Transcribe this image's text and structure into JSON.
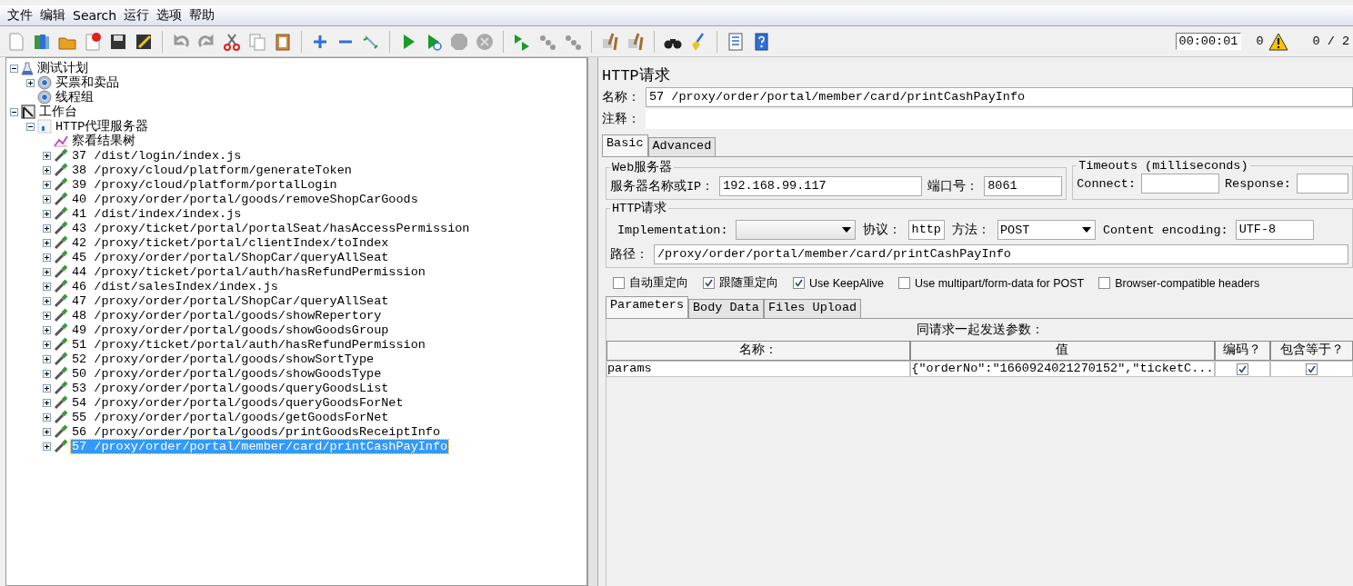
{
  "menu": [
    "文件",
    "编辑",
    "Search",
    "运行",
    "选项",
    "帮助"
  ],
  "status": {
    "timer": "00:00:01",
    "warnings": "0",
    "threads": "0 / 2"
  },
  "tree": [
    {
      "label": "测试计划",
      "kind": "plan",
      "expanded": true,
      "selected": false,
      "children": [
        {
          "label": "买票和卖品",
          "kind": "thread-group",
          "expanded": false,
          "selected": false
        },
        {
          "label": "线程组",
          "kind": "thread-group",
          "selected": false
        }
      ]
    },
    {
      "label": "工作台",
      "kind": "workbench",
      "expanded": true,
      "selected": false,
      "children": [
        {
          "label": "HTTP代理服务器",
          "kind": "proxy",
          "expanded": true,
          "selected": false,
          "children": [
            {
              "label": "察看结果树",
              "kind": "listener",
              "selected": false
            },
            {
              "label": "37 /dist/login/index.js",
              "kind": "sampler",
              "expanded": false,
              "selected": false
            },
            {
              "label": "38 /proxy/cloud/platform/generateToken",
              "kind": "sampler",
              "expanded": false,
              "selected": false
            },
            {
              "label": "39 /proxy/cloud/platform/portalLogin",
              "kind": "sampler",
              "expanded": false,
              "selected": false
            },
            {
              "label": "40 /proxy/order/portal/goods/removeShopCarGoods",
              "kind": "sampler",
              "expanded": false,
              "selected": false
            },
            {
              "label": "41 /dist/index/index.js",
              "kind": "sampler",
              "expanded": false,
              "selected": false
            },
            {
              "label": "43 /proxy/ticket/portal/portalSeat/hasAccessPermission",
              "kind": "sampler",
              "expanded": false,
              "selected": false
            },
            {
              "label": "42 /proxy/ticket/portal/clientIndex/toIndex",
              "kind": "sampler",
              "expanded": false,
              "selected": false
            },
            {
              "label": "45 /proxy/order/portal/ShopCar/queryAllSeat",
              "kind": "sampler",
              "expanded": false,
              "selected": false
            },
            {
              "label": "44 /proxy/ticket/portal/auth/hasRefundPermission",
              "kind": "sampler",
              "expanded": false,
              "selected": false
            },
            {
              "label": "46 /dist/salesIndex/index.js",
              "kind": "sampler",
              "expanded": false,
              "selected": false
            },
            {
              "label": "47 /proxy/order/portal/ShopCar/queryAllSeat",
              "kind": "sampler",
              "expanded": false,
              "selected": false
            },
            {
              "label": "48 /proxy/order/portal/goods/showRepertory",
              "kind": "sampler",
              "expanded": false,
              "selected": false
            },
            {
              "label": "49 /proxy/order/portal/goods/showGoodsGroup",
              "kind": "sampler",
              "expanded": false,
              "selected": false
            },
            {
              "label": "51 /proxy/ticket/portal/auth/hasRefundPermission",
              "kind": "sampler",
              "expanded": false,
              "selected": false
            },
            {
              "label": "52 /proxy/order/portal/goods/showSortType",
              "kind": "sampler",
              "expanded": false,
              "selected": false
            },
            {
              "label": "50 /proxy/order/portal/goods/showGoodsType",
              "kind": "sampler",
              "expanded": false,
              "selected": false
            },
            {
              "label": "53 /proxy/order/portal/goods/queryGoodsList",
              "kind": "sampler",
              "expanded": false,
              "selected": false
            },
            {
              "label": "54 /proxy/order/portal/goods/queryGoodsForNet",
              "kind": "sampler",
              "expanded": false,
              "selected": false
            },
            {
              "label": "55 /proxy/order/portal/goods/getGoodsForNet",
              "kind": "sampler",
              "expanded": false,
              "selected": false
            },
            {
              "label": "56 /proxy/order/portal/goods/printGoodsReceiptInfo",
              "kind": "sampler",
              "expanded": false,
              "selected": false
            },
            {
              "label": "57 /proxy/order/portal/member/card/printCashPayInfo",
              "kind": "sampler",
              "expanded": false,
              "selected": true
            }
          ]
        }
      ]
    }
  ],
  "panel": {
    "title": "HTTP请求",
    "name_label": "名称：",
    "name_value": "57 /proxy/order/portal/member/card/printCashPayInfo",
    "comment_label": "注释：",
    "tabs": [
      {
        "label": "Basic",
        "selected": true
      },
      {
        "label": "Advanced",
        "selected": false
      }
    ],
    "web_server": {
      "legend": "Web服务器",
      "server_label": "服务器名称或IP：",
      "server_value": "192.168.99.117",
      "port_label": "端口号：",
      "port_value": "8061"
    },
    "timeouts": {
      "legend": "Timeouts (milliseconds)",
      "connect_label": "Connect:",
      "response_label": "Response:"
    },
    "http_request": {
      "legend": "HTTP请求",
      "implementation_label": "Implementation:",
      "protocol_label": "协议：",
      "protocol_value": "http",
      "method_label": "方法：",
      "method_value": "POST",
      "encoding_label": "Content encoding:",
      "encoding_value": "UTF-8",
      "path_label": "路径：",
      "path_value": "/proxy/order/portal/member/card/printCashPayInfo"
    },
    "options": [
      {
        "label": "自动重定向",
        "checked": false
      },
      {
        "label": "跟随重定向",
        "checked": true
      },
      {
        "label": "Use KeepAlive",
        "checked": true
      },
      {
        "label": "Use multipart/form-data for POST",
        "checked": false
      },
      {
        "label": "Browser-compatible headers",
        "checked": false
      }
    ],
    "param_tabs": [
      {
        "label": "Parameters",
        "selected": true
      },
      {
        "label": "Body Data",
        "selected": false
      },
      {
        "label": "Files Upload",
        "selected": false
      }
    ],
    "params": {
      "caption": "同请求一起发送参数：",
      "columns": [
        "名称：",
        "值",
        "编码？",
        "包含等于？"
      ],
      "rows": [
        {
          "name": "params",
          "value": "{\"orderNo\":\"1660924021270152\",\"ticketC...",
          "encode": true,
          "include_equals": true
        }
      ]
    }
  }
}
